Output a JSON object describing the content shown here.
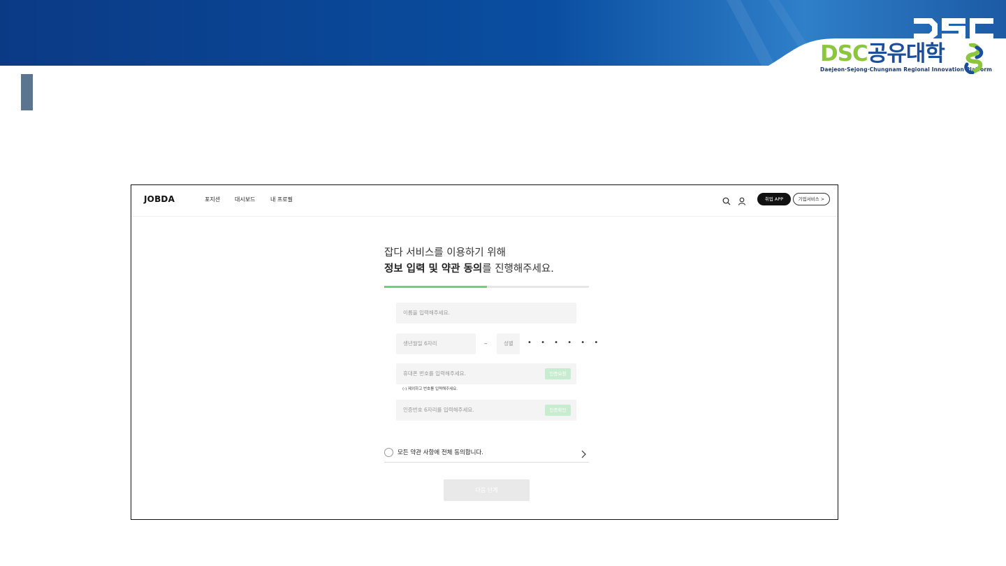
{
  "slide": {
    "colors": {
      "banner_dark": "#0b3a85",
      "banner_light": "#2f7fc9",
      "accent_bar": "#5a7590",
      "dsc_green": "#8cc63f",
      "dsc_blue": "#1b4f9c"
    },
    "logo": {
      "mark_text": "DSC",
      "word_dsc": "DSC",
      "word_korean": "공유대학",
      "subtitle": "Daejeon·Sejong·Chungnam Regional Innovation Platform"
    }
  },
  "jobda": {
    "brand": "JOBDA",
    "nav": {
      "positions": "포지션",
      "dashboard": "대시보드",
      "profile": "내 프로필"
    },
    "header_buttons": {
      "app": "취업 APP",
      "business": "기업서비스 >"
    },
    "icons": {
      "search": "search-icon",
      "user": "user-icon"
    },
    "heading": {
      "line1": "잡다 서비스를 이용하기 위해",
      "line2_bold": "정보 입력 및 약관 동의",
      "line2_rest": "를 진행해주세요."
    },
    "progress": {
      "fraction": 0.5,
      "color": "#6fce7f"
    },
    "form": {
      "name_placeholder": "이름을 입력해주세요.",
      "birth_placeholder": "생년월일 6자리",
      "dash": "–",
      "gender_placeholder": "성별",
      "masked": "• • • • • •",
      "phone_placeholder": "휴대폰 번호를 입력해주세요.",
      "send_code": "인증요청",
      "hint": "(-) 제외하고 번호를 입력해주세요.",
      "code_placeholder": "인증번호 6자리를 입력해주세요.",
      "verify_code": "인증확인"
    },
    "agree_all": "모든 약관 사항에 전체 동의합니다.",
    "next_button": "다음 단계"
  }
}
